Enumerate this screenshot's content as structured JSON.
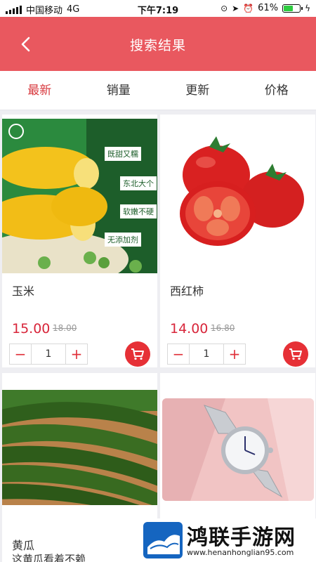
{
  "status_bar": {
    "carrier": "中国移动",
    "network": "4G",
    "time": "下午7:19",
    "battery_percent_text": "61%",
    "battery_level": 0.61
  },
  "header": {
    "title": "搜索结果",
    "back_icon": "chevron-left-icon"
  },
  "sort_tabs": [
    {
      "label": "最新",
      "active": true
    },
    {
      "label": "销量",
      "active": false
    },
    {
      "label": "更新",
      "active": false
    },
    {
      "label": "价格",
      "active": false
    }
  ],
  "products": [
    {
      "name": "玉米",
      "price": "15.00",
      "old_price": "18.00",
      "quantity": "1",
      "image_tags": [
        "既甜又糯",
        "东北大个",
        "软嫩不硬",
        "无添加剂"
      ]
    },
    {
      "name": "西红柿",
      "price": "14.00",
      "old_price": "16.80",
      "quantity": "1"
    },
    {
      "name": "黄瓜",
      "subtitle": "这黄瓜看着不赖"
    },
    {
      "name": ""
    }
  ],
  "watermark": {
    "title": "鸿联手游网",
    "url": "www.henanhonglian95.com"
  },
  "colors": {
    "brand_red": "#e9585f",
    "price_red": "#d8253a",
    "cart_red": "#e63036"
  }
}
